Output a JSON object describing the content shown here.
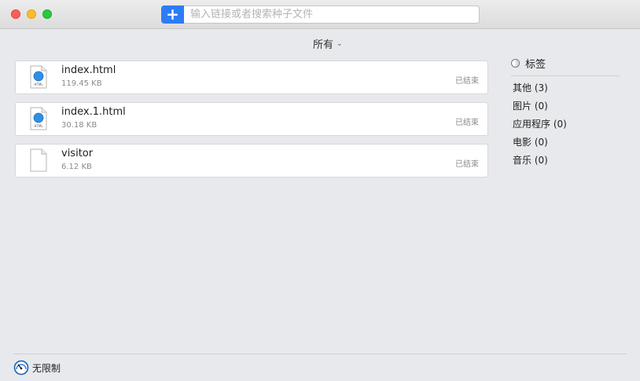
{
  "toolbar": {
    "add_label": "+",
    "search_placeholder": "输入链接或者搜索种子文件"
  },
  "filter": {
    "label": "所有"
  },
  "downloads": [
    {
      "name": "index.html",
      "size": "119.45 KB",
      "status": "已结束",
      "icon": "html-file-icon"
    },
    {
      "name": "index.1.html",
      "size": "30.18 KB",
      "status": "已结束",
      "icon": "html-file-icon"
    },
    {
      "name": "visitor",
      "size": "6.12 KB",
      "status": "已结束",
      "icon": "blank-file-icon"
    }
  ],
  "sidebar": {
    "tags_label": "标签",
    "categories": [
      {
        "label": "其他 (3)"
      },
      {
        "label": "图片 (0)"
      },
      {
        "label": "应用程序 (0)"
      },
      {
        "label": "电影 (0)"
      },
      {
        "label": "音乐 (0)"
      }
    ]
  },
  "footer": {
    "speed_label": "无限制",
    "icon": "speedometer-icon"
  },
  "colors": {
    "accent": "#2c7cf6",
    "close": "#fc5f57",
    "minimize": "#fdbc2e",
    "maximize": "#28c840"
  }
}
